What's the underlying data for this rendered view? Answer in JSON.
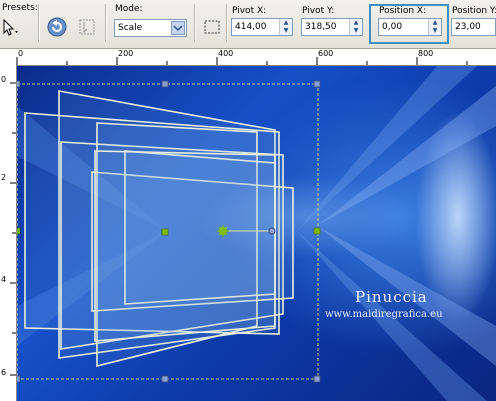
{
  "toolbar": {
    "presets_label": "Presets:",
    "mode_label": "Mode:",
    "mode_value": "Scale",
    "pivot_x_label": "Pivot X:",
    "pivot_x_value": "414,00",
    "pivot_y_label": "Pivot Y:",
    "pivot_y_value": "318,50",
    "position_x_label": "Position X:",
    "position_x_value": "0,00",
    "position_y_label": "Position Y:",
    "position_y_value": "23,00"
  },
  "ruler": {
    "top_numbers": [
      "0",
      "200",
      "400",
      "600",
      "800"
    ],
    "left_numbers": [
      "0",
      "2",
      "4",
      "6"
    ]
  },
  "canvas": {
    "watermark_title": "Pinuccia",
    "watermark_site": "www.maidiregrafica.eu"
  },
  "colors": {
    "highlight": "#3f8fc2",
    "handle_green": "#7fbf00",
    "handle_blue": "#8aa0d0"
  }
}
